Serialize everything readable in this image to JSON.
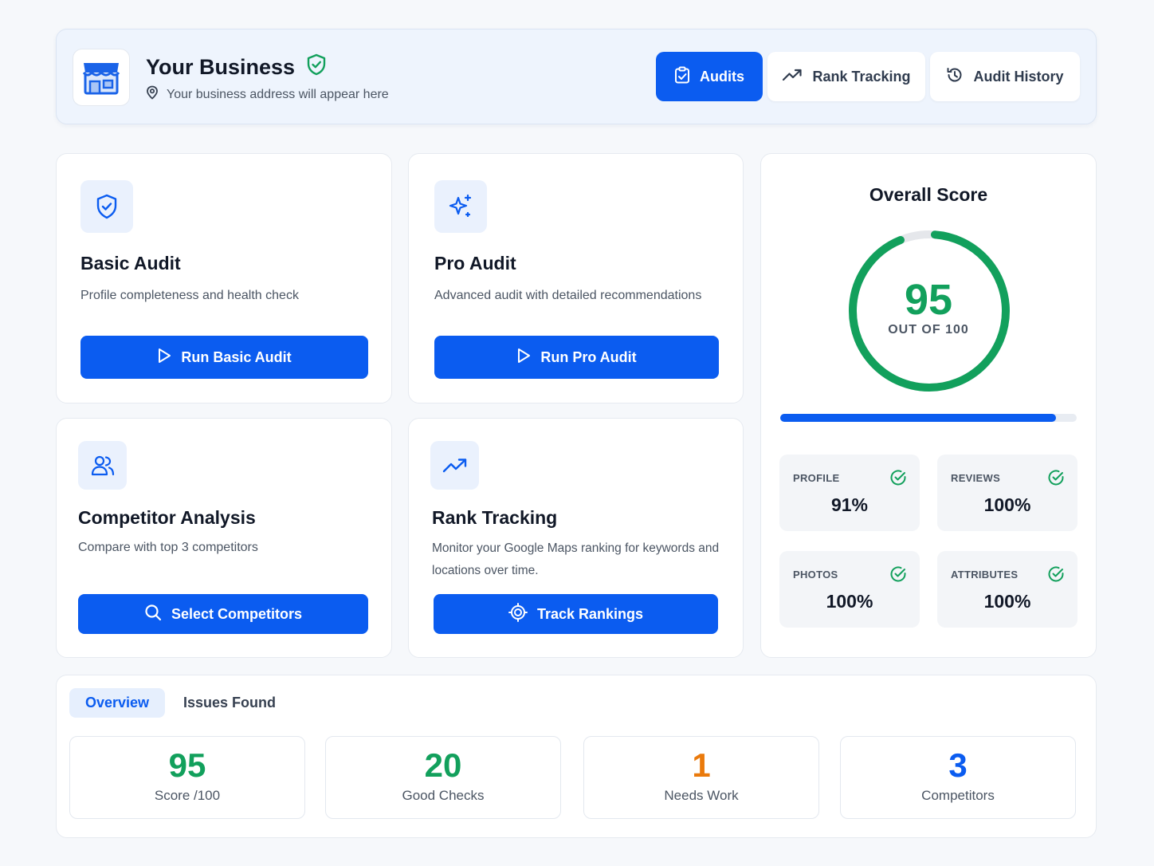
{
  "header": {
    "business_name": "Your Business",
    "business_address": "Your business address will appear here",
    "nav": [
      {
        "label": "Audits",
        "icon": "clipboard-check-icon",
        "active": true
      },
      {
        "label": "Rank Tracking",
        "icon": "trending-up-icon",
        "active": false
      },
      {
        "label": "Audit History",
        "icon": "history-icon",
        "active": false
      }
    ]
  },
  "cards": {
    "basic": {
      "title": "Basic Audit",
      "desc": "Profile completeness and health check",
      "button": "Run Basic Audit",
      "icon": "shield-check-icon"
    },
    "pro": {
      "title": "Pro Audit",
      "desc": "Advanced audit with detailed recommendations",
      "button": "Run Pro Audit",
      "icon": "sparkles-icon"
    },
    "competitor": {
      "title": "Competitor Analysis",
      "desc": "Compare with top 3 competitors",
      "button": "Select Competitors",
      "icon": "users-icon"
    },
    "rank": {
      "title": "Rank Tracking",
      "desc": "Monitor your Google Maps ranking for keywords and locations over time.",
      "button": "Track Rankings",
      "icon": "trending-up-icon"
    }
  },
  "score": {
    "title": "Overall Score",
    "value": "95",
    "subtitle": "OUT OF 100",
    "progress": 0.93,
    "metrics": [
      {
        "label": "PROFILE",
        "value": "91%"
      },
      {
        "label": "REVIEWS",
        "value": "100%"
      },
      {
        "label": "PHOTOS",
        "value": "100%"
      },
      {
        "label": "ATTRIBUTES",
        "value": "100%"
      }
    ]
  },
  "bottom": {
    "tabs": [
      {
        "label": "Overview",
        "active": true
      },
      {
        "label": "Issues Found",
        "active": false
      }
    ],
    "stats": [
      {
        "value": "95",
        "label": "Score /100",
        "color": "#12a05c"
      },
      {
        "value": "20",
        "label": "Good Checks",
        "color": "#12a05c"
      },
      {
        "value": "1",
        "label": "Needs Work",
        "color": "#ea7a0c"
      },
      {
        "value": "3",
        "label": "Competitors",
        "color": "#0b5cf0"
      }
    ]
  },
  "colors": {
    "accent": "#0b5cf0",
    "success": "#12a05c",
    "warning": "#ea7a0c"
  }
}
